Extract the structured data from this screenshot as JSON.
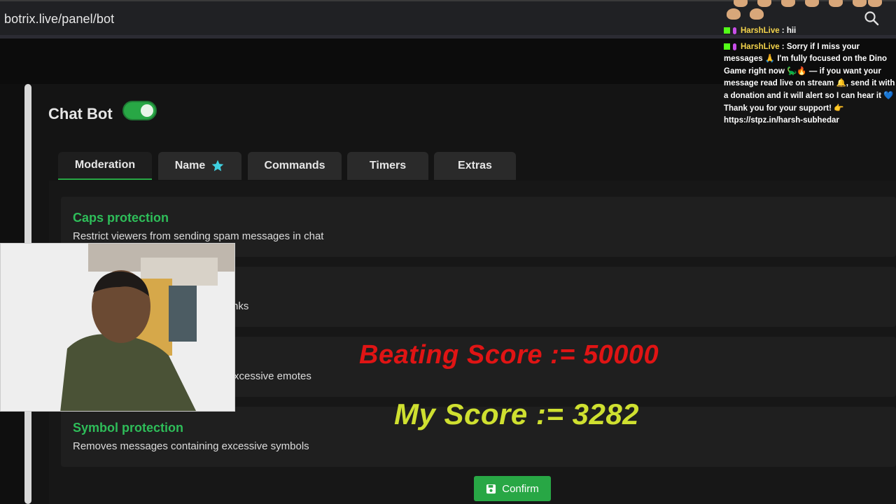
{
  "browser": {
    "url": "botrix.live/panel/bot"
  },
  "panel": {
    "title": "Chat Bot",
    "toggle_on": true,
    "tabs": [
      {
        "label": "Moderation",
        "active": true
      },
      {
        "label": "Name",
        "icon": "star-icon"
      },
      {
        "label": "Commands"
      },
      {
        "label": "Timers"
      },
      {
        "label": "Extras"
      }
    ],
    "cards": [
      {
        "title": "Caps protection",
        "desc": "Restrict viewers from sending spam messages in chat"
      },
      {
        "title": "",
        "desc": "nks"
      },
      {
        "title": "",
        "desc": "xcessive emotes"
      },
      {
        "title": "Symbol protection",
        "desc": "Removes messages containing excessive symbols"
      }
    ],
    "confirm_label": "Confirm"
  },
  "overlay": {
    "beating_score": "Beating Score := 50000",
    "my_score": "My Score := 3282"
  },
  "chat": {
    "messages": [
      {
        "user": "HarshLive",
        "text": " : hii"
      },
      {
        "user": "HarshLive",
        "text": " : Sorry if I miss your messages 🙏 I'm fully focused on the Dino Game right now 🦕🔥 — if you want your message read live on stream 🔔, send it with a donation and it will alert so I can hear it 💙 Thank you for your support! 👉 https://stpz.in/harsh-subhedar"
      }
    ]
  },
  "colors": {
    "accent_green": "#28a745",
    "card_title_green": "#2ebd59",
    "beat_red": "#e01414",
    "my_yellow": "#cfe030"
  }
}
